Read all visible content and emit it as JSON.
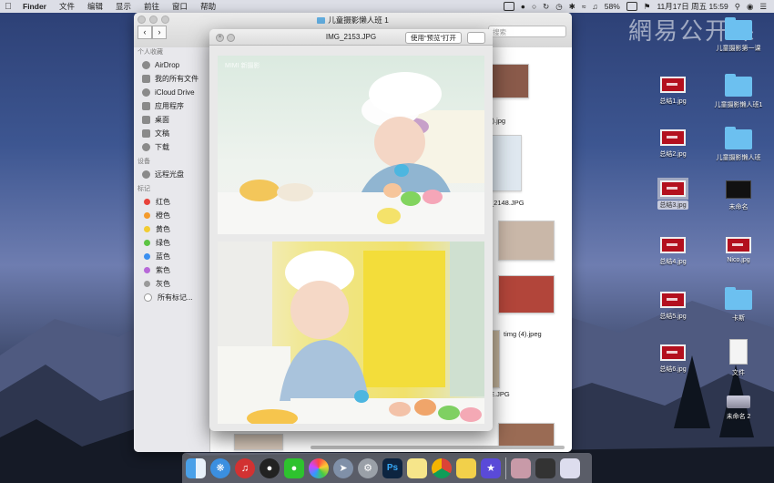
{
  "menubar": {
    "app_name": "Finder",
    "menus": [
      "文件",
      "编辑",
      "显示",
      "前往",
      "窗口",
      "帮助"
    ],
    "battery": "58%",
    "clock": "11月17日 周五 15:59"
  },
  "watermark": "網易公开课",
  "finder": {
    "title": "儿童摄影懒人班 1",
    "search_placeholder": "搜索",
    "sidebar": {
      "favorites_header": "个人收藏",
      "favorites": [
        "AirDrop",
        "我的所有文件",
        "iCloud Drive",
        "应用程序",
        "桌面",
        "文稿",
        "下载"
      ],
      "devices_header": "设备",
      "devices": [
        "远程光盘"
      ],
      "tags_header": "标记",
      "tags": [
        {
          "label": "红色",
          "color": "#e8423a"
        },
        {
          "label": "橙色",
          "color": "#f49a2b"
        },
        {
          "label": "黄色",
          "color": "#f2cc33"
        },
        {
          "label": "绿色",
          "color": "#5cc443"
        },
        {
          "label": "蓝色",
          "color": "#3b8ff0"
        },
        {
          "label": "紫色",
          "color": "#b768d8"
        },
        {
          "label": "灰色",
          "color": "#9a9a9a"
        },
        {
          "label": "所有标记...",
          "color": ""
        }
      ]
    },
    "file_labels": [
      ")).jpg",
      "_2148.JPG",
      "timg (4).jpeg",
      "E.JPG"
    ]
  },
  "preview": {
    "title": "IMG_2153.JPG",
    "open_button": "使用“预览”打开",
    "photo_caption": "MIMI 新摄影"
  },
  "desktop_icons": [
    {
      "label": "儿童摄影第一课",
      "kind": "folder"
    },
    {
      "label": "总结1.jpg",
      "kind": "image"
    },
    {
      "label": "儿童摄影懒人班1",
      "kind": "folder"
    },
    {
      "label": "总结2.jpg",
      "kind": "image"
    },
    {
      "label": "儿童摄影懒人班",
      "kind": "folder"
    },
    {
      "label": "总结3.jpg",
      "kind": "image"
    },
    {
      "label": "未命名",
      "kind": "black"
    },
    {
      "label": "总结4.jpg",
      "kind": "image"
    },
    {
      "label": "Nico.jpg",
      "kind": "image"
    },
    {
      "label": "总结5.jpg",
      "kind": "image"
    },
    {
      "label": "卡斯",
      "kind": "folder"
    },
    {
      "label": "总结6.jpg",
      "kind": "image"
    },
    {
      "label": "文件",
      "kind": "doc"
    },
    {
      "label": "未命名 2",
      "kind": "drive"
    }
  ],
  "dock_apps": [
    "finder-icon",
    "safari-icon",
    "netease-music-icon",
    "qq-icon",
    "wechat-icon",
    "photos-icon",
    "launchpad-icon",
    "system-preferences-icon",
    "photoshop-icon",
    "notes-icon",
    "chrome-icon",
    "stickies-icon",
    "imovie-icon",
    "photo-icon",
    "display-icon",
    "trash-icon"
  ],
  "dock_ps_label": "Ps"
}
